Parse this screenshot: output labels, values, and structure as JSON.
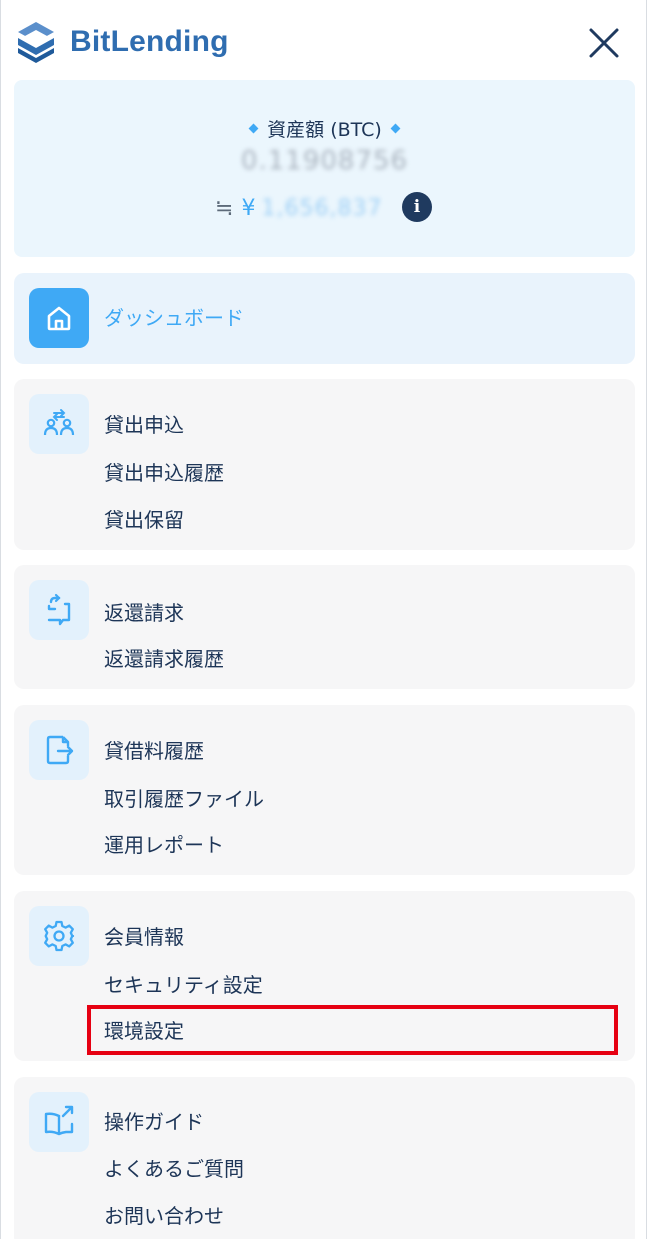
{
  "app": {
    "name": "BitLending",
    "brand_color": "#2f6db0",
    "accent": "#3fa9f5"
  },
  "header": {
    "close_icon": "close-icon"
  },
  "asset": {
    "title": "資産額 (BTC)",
    "btc_value": "0.11908756",
    "approx_symbol": "≒",
    "yen_symbol": "¥",
    "yen_value": "1,656,837",
    "info_icon": "i"
  },
  "menu": {
    "dashboard": {
      "label": "ダッシュボード",
      "icon": "home-icon"
    },
    "lending": {
      "icon": "people-exchange-icon",
      "items": [
        "貸出申込",
        "貸出申込履歴",
        "貸出保留"
      ]
    },
    "return": {
      "icon": "return-request-icon",
      "items": [
        "返還請求",
        "返還請求履歴"
      ]
    },
    "history": {
      "icon": "document-export-icon",
      "items": [
        "貸借料履歴",
        "取引履歴ファイル",
        "運用レポート"
      ]
    },
    "account": {
      "icon": "gear-icon",
      "items": [
        "会員情報",
        "セキュリティ設定",
        "環境設定"
      ]
    },
    "guide": {
      "icon": "book-external-icon",
      "items": [
        "操作ガイド",
        "よくあるご質問",
        "お問い合わせ"
      ]
    }
  },
  "highlight_color": "#e60012"
}
